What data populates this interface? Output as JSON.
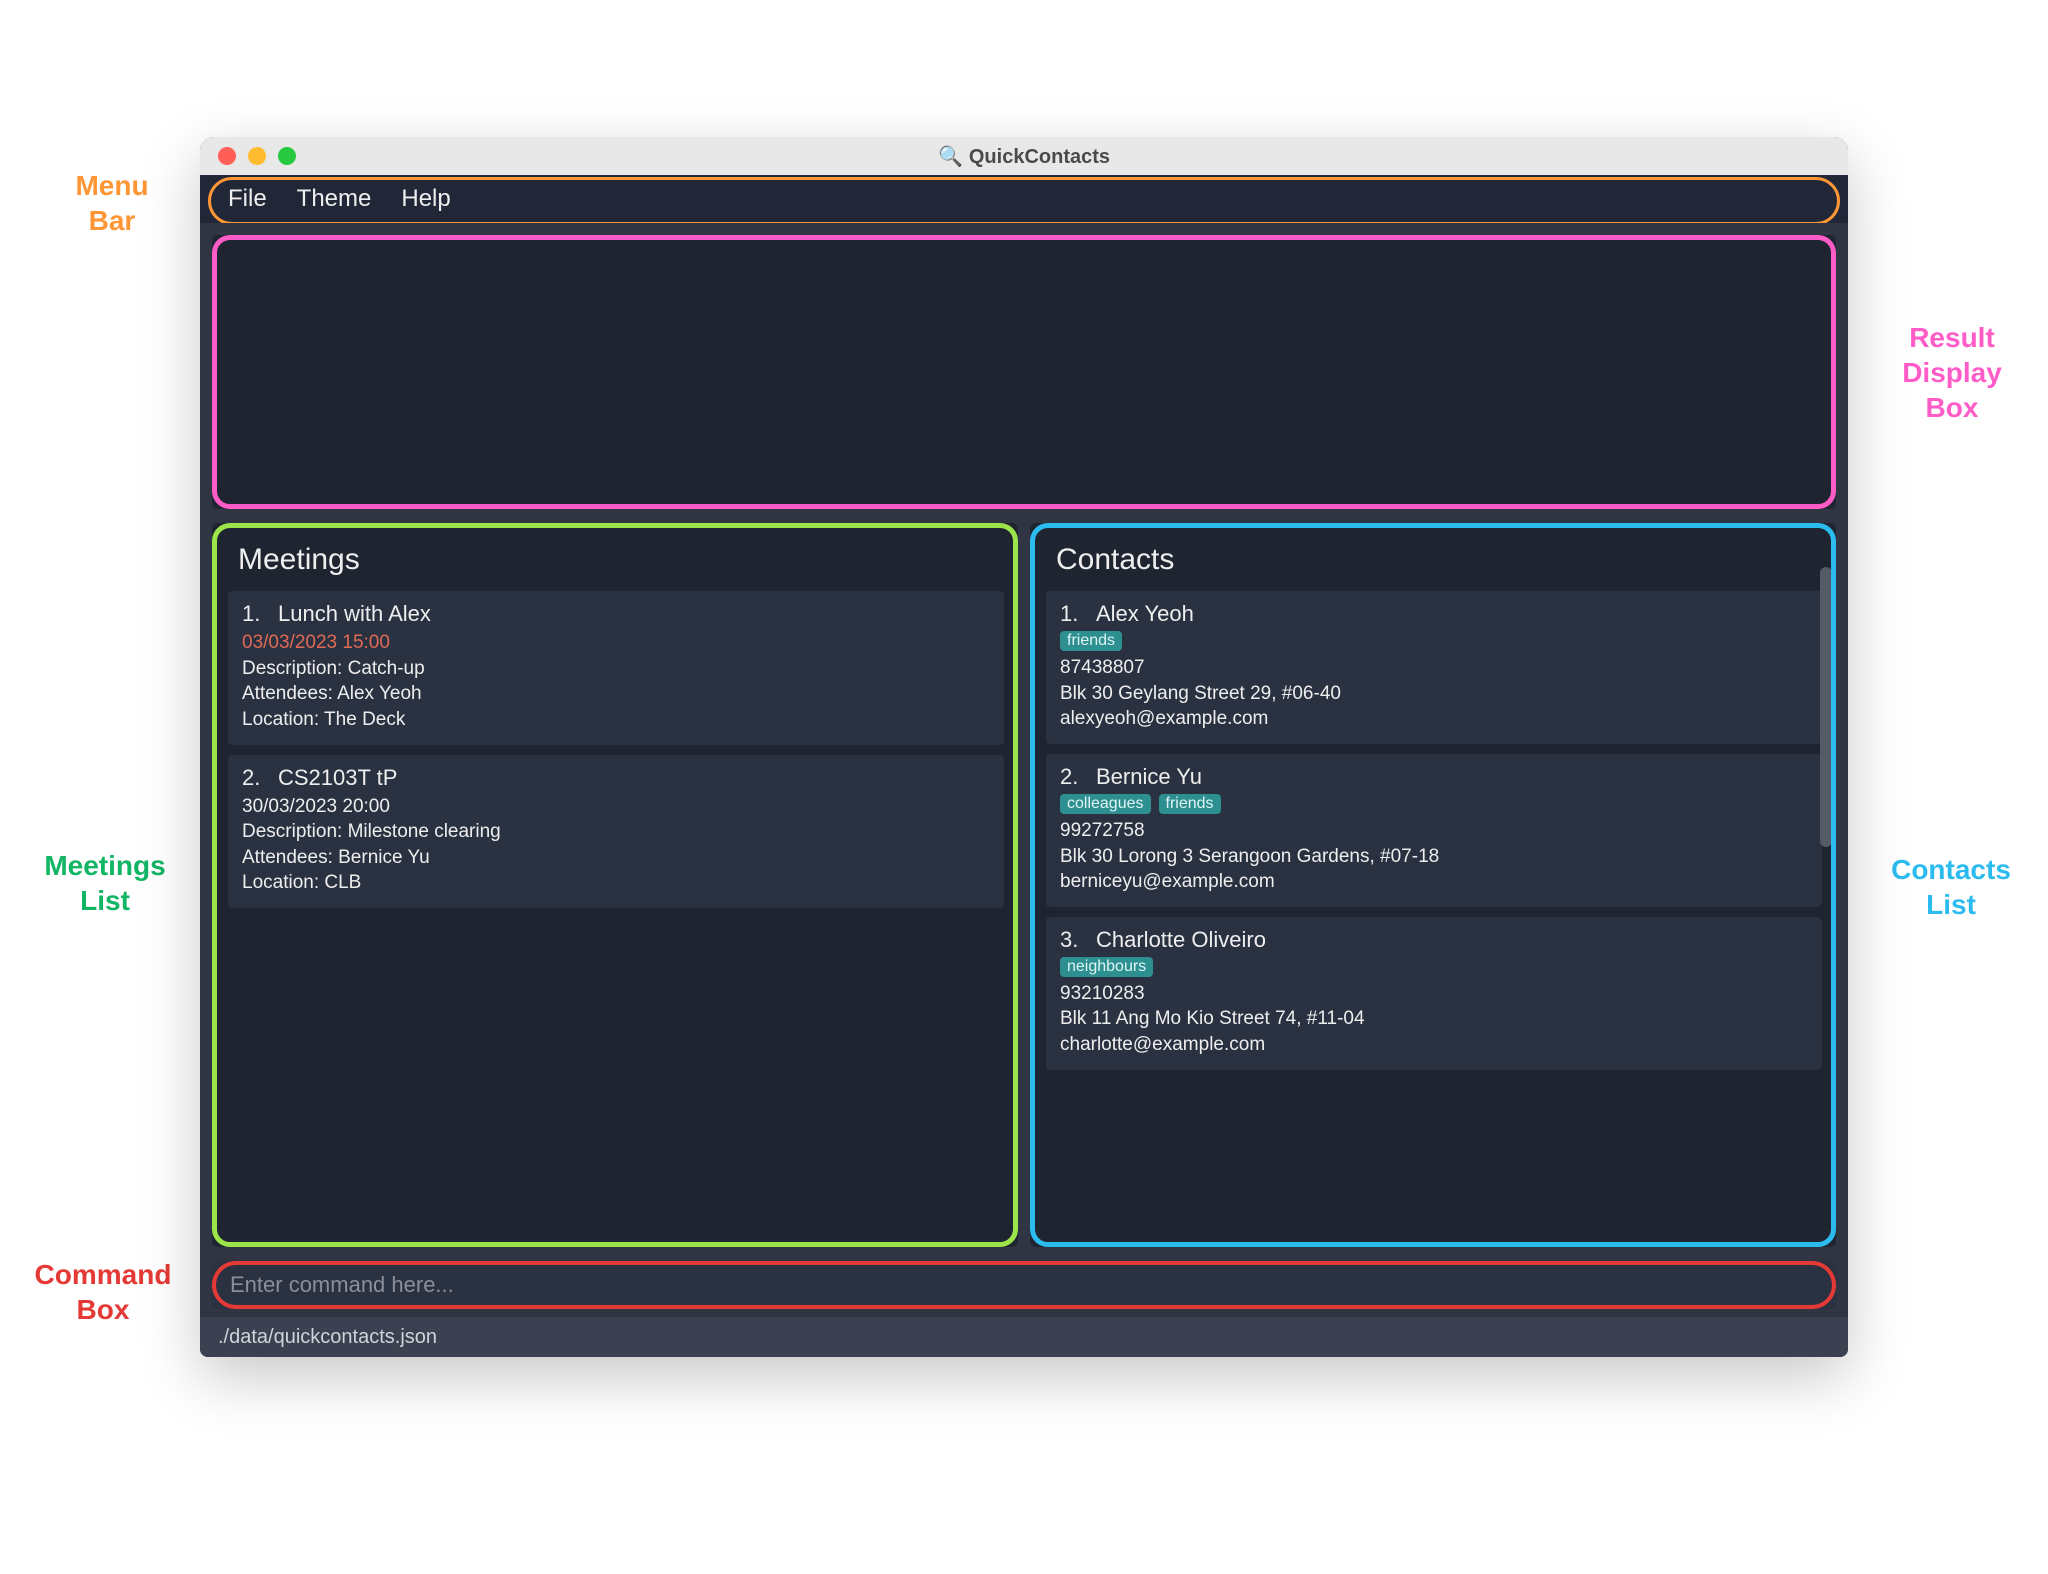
{
  "app": {
    "title": "QuickContacts",
    "title_emoji": "🔍"
  },
  "menubar": {
    "items": [
      "File",
      "Theme",
      "Help"
    ]
  },
  "result_display": {
    "text": ""
  },
  "meetings": {
    "title": "Meetings",
    "items": [
      {
        "index": "1.",
        "name": "Lunch with Alex",
        "datetime": "03/03/2023 15:00",
        "description": "Description: Catch-up",
        "attendees": "Attendees: Alex Yeoh",
        "location": "Location: The Deck",
        "accent": true
      },
      {
        "index": "2.",
        "name": "CS2103T tP",
        "datetime": "30/03/2023 20:00",
        "description": "Description: Milestone clearing",
        "attendees": "Attendees: Bernice Yu",
        "location": "Location: CLB",
        "accent": false
      }
    ]
  },
  "contacts": {
    "title": "Contacts",
    "items": [
      {
        "index": "1.",
        "name": "Alex Yeoh",
        "tags": [
          "friends"
        ],
        "phone": "87438807",
        "address": "Blk 30 Geylang Street 29, #06-40",
        "email": "alexyeoh@example.com"
      },
      {
        "index": "2.",
        "name": "Bernice Yu",
        "tags": [
          "colleagues",
          "friends"
        ],
        "phone": "99272758",
        "address": "Blk 30 Lorong 3 Serangoon Gardens, #07-18",
        "email": "berniceyu@example.com"
      },
      {
        "index": "3.",
        "name": "Charlotte Oliveiro",
        "tags": [
          "neighbours"
        ],
        "phone": "93210283",
        "address": "Blk 11 Ang Mo Kio Street 74, #11-04",
        "email": "charlotte@example.com"
      }
    ]
  },
  "command_box": {
    "placeholder": "Enter command here..."
  },
  "status_bar": {
    "path": "./data/quickcontacts.json"
  },
  "annotations": {
    "menu_bar": "Menu\nBar",
    "result_display_box": "Result\nDisplay\nBox",
    "meetings_list": "Meetings\nList",
    "contacts_list": "Contacts\nList",
    "command_box": "Command\nBox"
  },
  "colors": {
    "annotation_orange": "#ff9636",
    "annotation_pink": "#ff5cc8",
    "annotation_green": "#12b564",
    "annotation_cyan": "#2bbbef",
    "annotation_red": "#e53935",
    "bg_window": "#2f3542",
    "bg_panel": "#1e2430",
    "bg_card": "#2a3140",
    "accent_datetime": "#e06a56",
    "tag_bg": "#2d8f8f"
  }
}
